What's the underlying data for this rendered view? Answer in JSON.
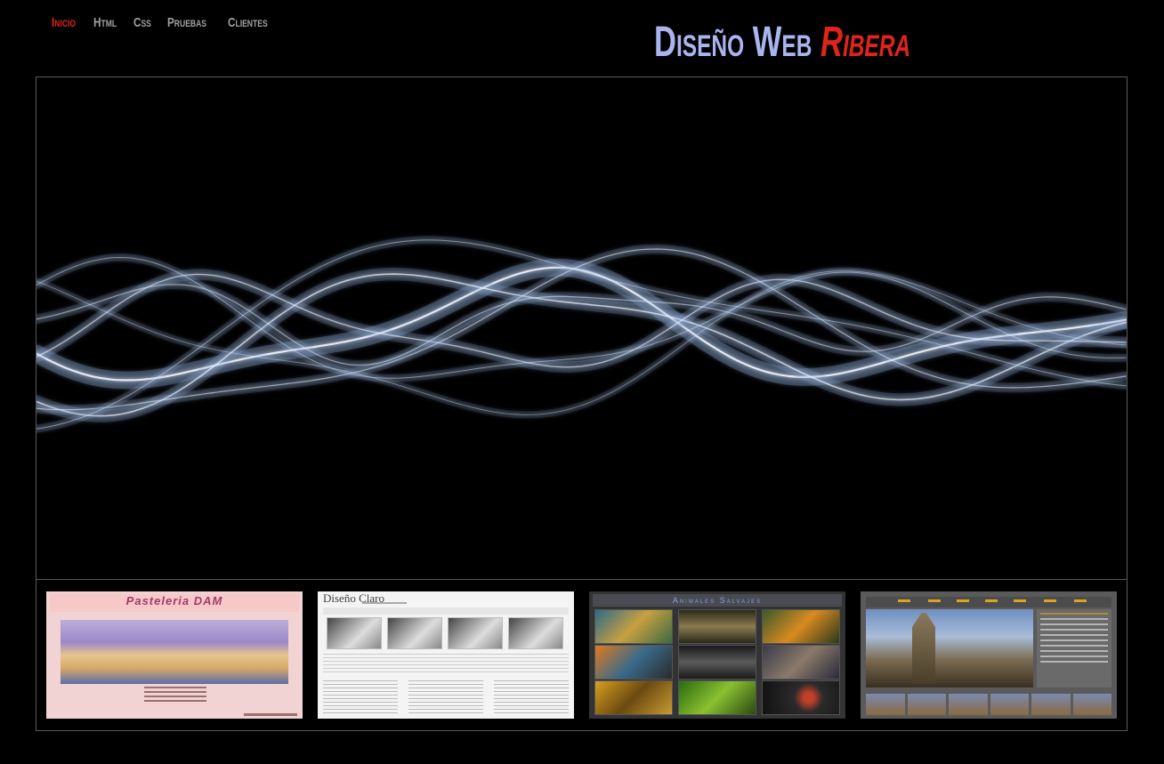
{
  "nav": {
    "items": [
      "Inicio",
      "Html",
      "Css",
      "Pruebas",
      "Clientes"
    ],
    "active": "Inicio"
  },
  "brand": {
    "word1": "Diseño",
    "word2": "Web",
    "word3": "Ribera"
  },
  "colors": {
    "accent_red": "#e0241b",
    "brand_blue": "#aab4ee",
    "background": "#000000",
    "border": "#5a5a5a"
  },
  "hero": {
    "image": "abstract-light-waves"
  },
  "thumbnails": [
    {
      "title": "Pasteleria DAM"
    },
    {
      "title": "Diseño Claro"
    },
    {
      "title": "Animales Salvajes"
    },
    {
      "title": ""
    }
  ]
}
